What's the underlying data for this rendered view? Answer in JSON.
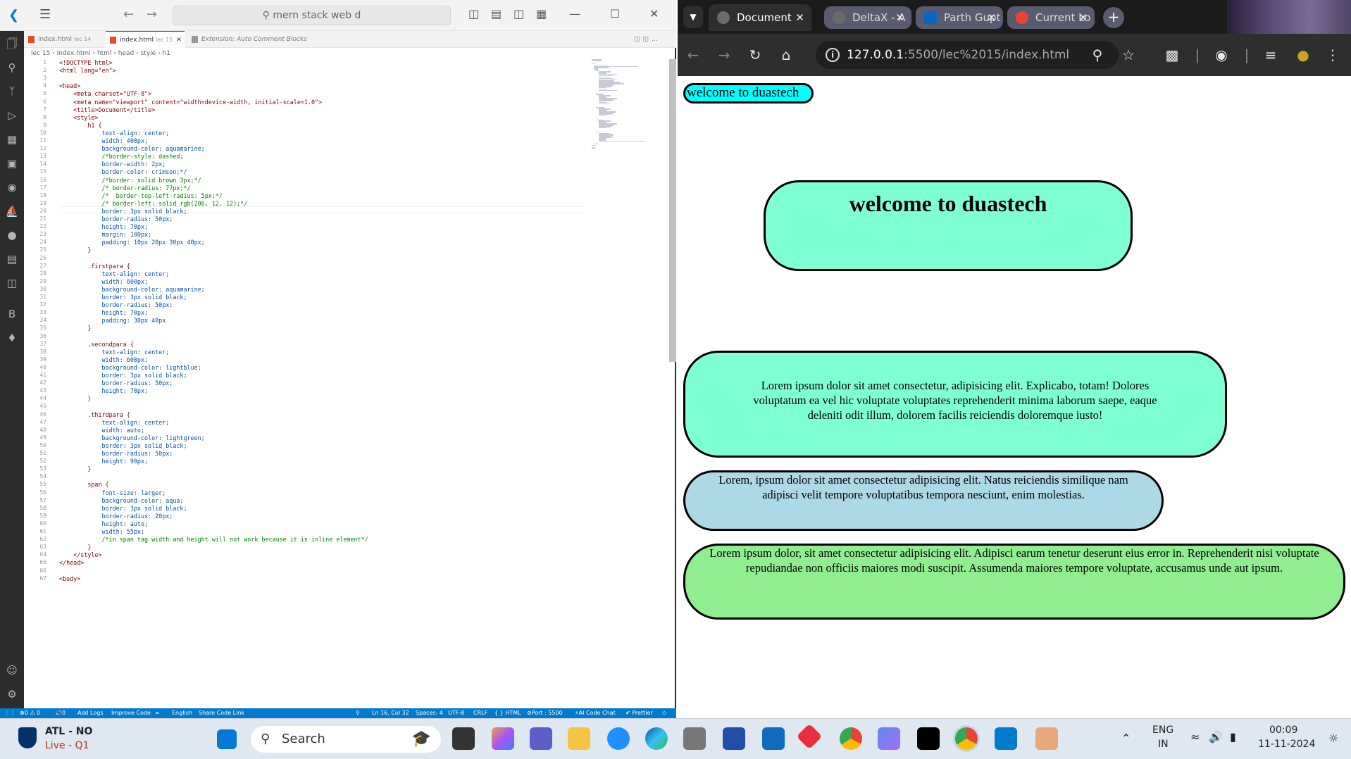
{
  "vscode": {
    "search_text": "mern stack web d",
    "tabs": [
      {
        "label": "index.html",
        "sub": "lec 14"
      },
      {
        "label": "index.html",
        "sub": "lec 15"
      },
      {
        "label": "Extension: Auto Comment Blocks",
        "sub": ""
      }
    ],
    "breadcrumb": [
      "lec 15",
      "index.html",
      "html",
      "head",
      "style",
      "h1"
    ],
    "code_lines": [
      "<!DOCTYPE html>",
      "<html lang=\"en\">",
      "",
      "<head>",
      "    <meta charset=\"UTF-8\">",
      "    <meta name=\"viewport\" content=\"width=device-width, initial-scale=1.0\">",
      "    <title>Document</title>",
      "    <style>",
      "        h1 {",
      "            text-align: center;",
      "            width: 400px;",
      "            background-color: aquamarine;",
      "            /*border-style: dashed;",
      "            border-width: 2px;",
      "            border-color: crimson;*/",
      "            /*border: solid brown 3px;*/",
      "            /* border-radius: 77px;*/",
      "            /*  border-top-left-radius: 5px;*/",
      "            /* border-left: solid rgb(206, 12, 12);*/",
      "            border: 3px solid black;",
      "            border-radius: 50px;",
      "            height: 70px;",
      "            margin: 100px;",
      "            padding: 10px 20px 30px 40px;",
      "        }",
      "",
      "        .firstpara {",
      "            text-align: center;",
      "            width: 600px;",
      "            background-color: aquamarine;",
      "            border: 3px solid black;",
      "            border-radius: 50px;",
      "            height: 70px;",
      "            padding: 30px 40px",
      "        }",
      "",
      "        .secondpara {",
      "            text-align: center;",
      "            width: 600px;",
      "            background-color: lightblue;",
      "            border: 3px solid black;",
      "            border-radius: 50px;",
      "            height: 70px;",
      "        }",
      "",
      "        .thirdpara {",
      "            text-align: center;",
      "            width: auto;",
      "            background-color: lightgreen;",
      "            border: 3px solid black;",
      "            border-radius: 50px;",
      "            height: 90px;",
      "        }",
      "",
      "        span {",
      "            font-size: larger;",
      "            background-color: aqua;",
      "            border: 3px solid black;",
      "            border-radius: 20px;",
      "            height: auto;",
      "            width: 55px;",
      "            /*in span tag width and height will not work because it is inline element*/",
      "        }",
      "    </style>",
      "</head>",
      "",
      "<body>"
    ],
    "status": {
      "errors": "0 ⚠ 0",
      "ports": "0",
      "add_logs": "Add Logs",
      "improve_code": "Improve Code",
      "language_tool": "English",
      "share": "Share Code Link",
      "position": "Ln 16, Col 32",
      "spaces": "Spaces: 4",
      "encoding": "UTF-8",
      "eol": "CRLF",
      "lang": "{ } HTML",
      "port": "Port : 5500",
      "ai_chat": "AI Code Chat",
      "prettier": "✔ Prettier"
    }
  },
  "chrome": {
    "tabs": [
      {
        "label": "Document"
      },
      {
        "label": "DeltaX - A"
      },
      {
        "label": "Parth Gupt"
      },
      {
        "label": "Current Lo"
      }
    ],
    "url_host": "127.0.0.1",
    "url_path": ":5500/lec%2015/index.html"
  },
  "page": {
    "span_text": "welcome to duastech",
    "h1_text": "welcome to duastech",
    "first_para": "Lorem ipsum dolor sit amet consectetur, adipisicing elit. Explicabo, totam! Dolores voluptatum ea vel hic voluptate voluptates reprehenderit minima laborum saepe, eaque deleniti odit illum, dolorem facilis reiciendis doloremque iusto!",
    "second_para": "Lorem, ipsum dolor sit amet consectetur adipisicing elit. Natus reiciendis similique nam adipisci velit tempore voluptatibus tempora nesciunt, enim molestias.",
    "third_para": "Lorem ipsum dolor, sit amet consectetur adipisicing elit. Adipisci earum tenetur deserunt eius error in. Reprehenderit nisi voluptate repudiandae non officiis maiores modi suscipit. Assumenda maiores tempore voluptate, accusamus unde aut ipsum."
  },
  "taskbar": {
    "score_line1": "ATL - NO",
    "score_line2": "Live - Q1",
    "search_label": "Search",
    "lang1": "ENG",
    "lang2": "IN",
    "time": "00:09",
    "date": "11-11-2024"
  }
}
